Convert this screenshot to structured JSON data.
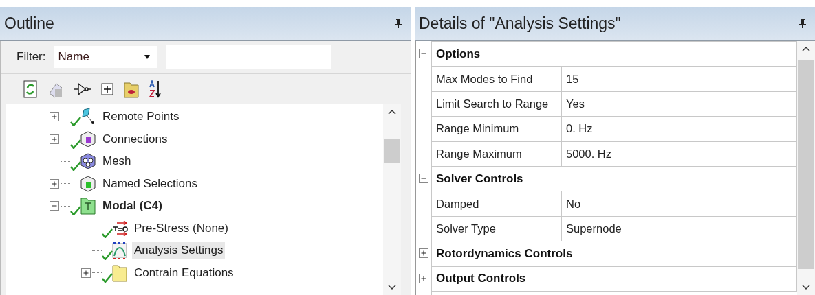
{
  "outline": {
    "title": "Outline",
    "filter": {
      "label": "Filter:",
      "value": "Name"
    },
    "tree": [
      {
        "label": "Remote Points",
        "kind": "points",
        "expanded": false,
        "checked": true,
        "selected": false
      },
      {
        "label": "Connections",
        "kind": "connections",
        "expanded": false,
        "checked": true,
        "selected": false
      },
      {
        "label": "Mesh",
        "kind": "mesh",
        "checked": true,
        "selected": false
      },
      {
        "label": "Named Selections",
        "kind": "selections",
        "expanded": false,
        "checked": false,
        "selected": false
      },
      {
        "label": "Modal (C4)",
        "kind": "environment",
        "expanded": true,
        "checked": true,
        "selected": false,
        "children": [
          {
            "label": "Pre-Stress (None)",
            "kind": "prestress",
            "checked": true,
            "selected": false
          },
          {
            "label": "Analysis Settings",
            "kind": "settings",
            "checked": true,
            "selected": true
          },
          {
            "label": "Contrain Equations",
            "kind": "folder",
            "expanded": false,
            "checked": true,
            "selected": false
          }
        ]
      }
    ]
  },
  "details": {
    "title": "Details of \"Analysis Settings\"",
    "sections": [
      {
        "title": "Options",
        "expanded": true,
        "rows": [
          {
            "name": "Max Modes to Find",
            "value": "15"
          },
          {
            "name": "Limit Search to Range",
            "value": "Yes"
          },
          {
            "name": "Range Minimum",
            "value": "0. Hz"
          },
          {
            "name": "Range Maximum",
            "value": "5000. Hz"
          }
        ]
      },
      {
        "title": "Solver Controls",
        "expanded": true,
        "rows": [
          {
            "name": "Damped",
            "value": "No"
          },
          {
            "name": "Solver Type",
            "value": "Supernode"
          }
        ]
      },
      {
        "title": "Rotordynamics Controls",
        "expanded": false
      },
      {
        "title": "Output Controls",
        "expanded": false
      }
    ]
  }
}
